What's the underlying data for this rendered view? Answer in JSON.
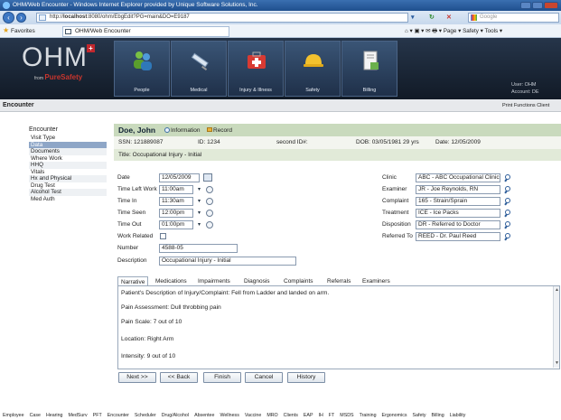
{
  "browser": {
    "window_title": "OHM/Web Encounter - Windows Internet Explorer provided by Unique Software Solutions, Inc.",
    "address_prefix": "http://",
    "address_host": "localhost",
    "address_rest": ":8080/ohm/EbgEdit?PG=main&DO=E9187",
    "search_placeholder": "Google",
    "favorites_label": "Favorites",
    "tab_title": "OHM/Web Encounter",
    "command_bar": "⌂ ▾ ▣ ▾ ✉ 🖶 ▾ Page ▾ Safety ▾ Tools ▾"
  },
  "banner": {
    "logo": "OHM",
    "logo_sub_from": "from",
    "logo_sub_brand": "PureSafety",
    "nav": [
      {
        "label": "People",
        "icon": "people-icon"
      },
      {
        "label": "Medical",
        "icon": "syringe-icon"
      },
      {
        "label": "Injury & Illness",
        "icon": "first-aid-kit-icon"
      },
      {
        "label": "Safety",
        "icon": "hard-hat-icon"
      },
      {
        "label": "Billing",
        "icon": "billing-document-icon"
      }
    ],
    "user_line": "User: OHM",
    "account_line": "Account: DE"
  },
  "subbar": {
    "title": "Encounter",
    "tools": "Print   Functions   Client"
  },
  "sidebar": {
    "heading": "Encounter",
    "items": [
      "Visit Type",
      "Data",
      "Documents",
      "Where Work",
      "HHQ",
      "Vitals",
      "Hx and Physical",
      "Drug Test",
      "Alcohol Test",
      "Med Auth"
    ],
    "active_index": 1
  },
  "patient": {
    "name": "Doe, John",
    "info_label": "Information",
    "record_label": "Record",
    "ssn": "SSN: 121889087",
    "id": "ID: 1234",
    "second_id": "second ID#:",
    "dob": "DOB: 03/05/1981 29 yrs",
    "date": "Date: 12/05/2009",
    "title": "Title: Occupational Injury - Initial"
  },
  "form": {
    "date_label": "Date",
    "date_value": "12/05/2009",
    "time_left_label": "Time Left Work",
    "time_left_value": "11:00am",
    "time_in_label": "Time In",
    "time_in_value": "11:30am",
    "time_seen_label": "Time Seen",
    "time_seen_value": "12:00pm",
    "time_out_label": "Time Out",
    "time_out_value": "01:00pm",
    "work_related_label": "Work Related",
    "work_related_checked": false,
    "number_label": "Number",
    "number_value": "4588-05",
    "description_label": "Description",
    "description_value": "Occupational Injury - Initial",
    "clinic_label": "Clinic",
    "clinic_value": "ABC - ABC Occupational Clinic",
    "examiner_label": "Examiner",
    "examiner_value": "JR - Joe Reynolds, RN",
    "complaint_label": "Complaint",
    "complaint_value": "165 - Strain/Sprain",
    "treatment_label": "Treatment",
    "treatment_value": "ICE - Ice Packs",
    "disposition_label": "Disposition",
    "disposition_value": "DR - Referred to Doctor",
    "referred_label": "Referred To",
    "referred_value": "REED - Dr. Paul Reed"
  },
  "tabs": [
    "Narrative",
    "Medications",
    "Impairments",
    "Diagnosis",
    "Complaints",
    "Referrals",
    "Examiners"
  ],
  "active_tab": "Narrative",
  "narrative": [
    "Patient's Description of Injury/Complaint: Fell from Ladder and landed on arm.",
    "Pain Assessment: Dull throbbing pain",
    "Pain Scale: 7 out of 10",
    "Location: Right Arm",
    "Intensity: 9 out of 10"
  ],
  "buttons": {
    "next": "Next >>",
    "back": "<< Back",
    "finish": "Finish",
    "cancel": "Cancel",
    "history": "History"
  },
  "footer": [
    "Employee",
    "Case",
    "Hearing",
    "MedSurv",
    "PFT",
    "Encounter",
    "Scheduler",
    "Drug/Alcohol",
    "Absentee",
    "Wellness",
    "Vaccine",
    "MRO",
    "Clients",
    "EAP",
    "IH",
    "FT",
    "MSDS",
    "Training",
    "Ergonomics",
    "Safety",
    "Billing",
    "Liability"
  ]
}
